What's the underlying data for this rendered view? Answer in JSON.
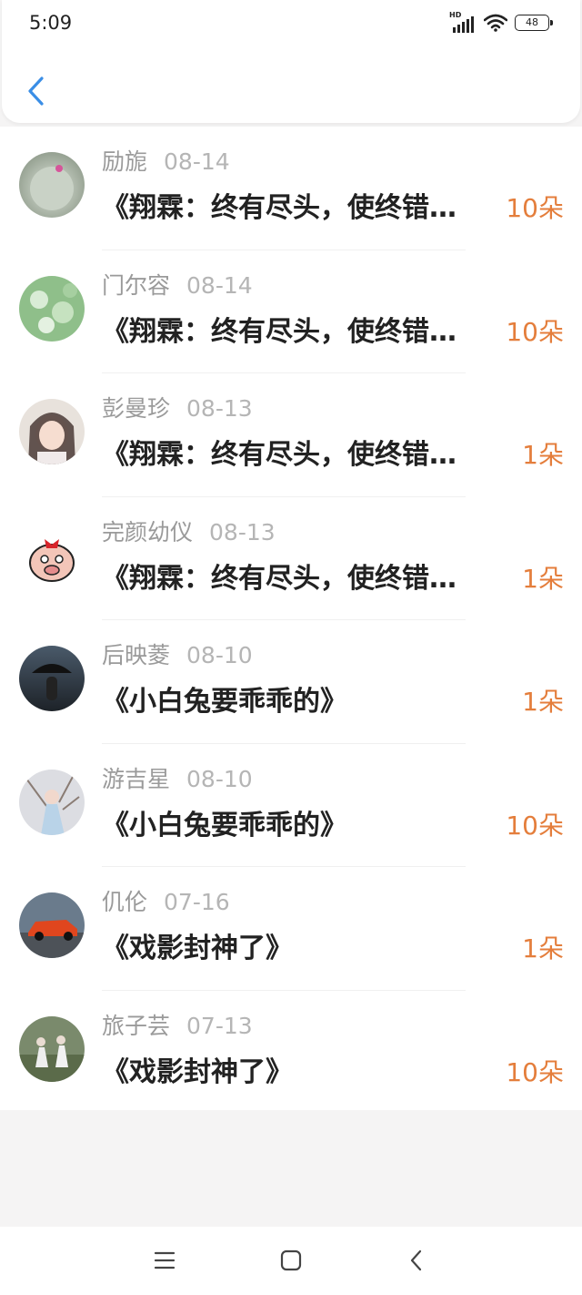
{
  "status_bar": {
    "time": "5:09",
    "signal_label": "HD",
    "battery_level": "48",
    "icons": [
      "signal-icon",
      "wifi-icon",
      "battery-icon"
    ]
  },
  "header": {
    "back_icon": "chevron-left-icon",
    "accent_color": "#3a8ee6"
  },
  "list": {
    "items": [
      {
        "name": "励旎",
        "date": "08-14",
        "title": "《翔霖：终有尽头，使终错…",
        "count": "10朵"
      },
      {
        "name": "门尔容",
        "date": "08-14",
        "title": "《翔霖：终有尽头，使终错…",
        "count": "10朵"
      },
      {
        "name": "彭曼珍",
        "date": "08-13",
        "title": "《翔霖：终有尽头，使终错…",
        "count": "1朵"
      },
      {
        "name": "完颜幼仪",
        "date": "08-13",
        "title": "《翔霖：终有尽头，使终错…",
        "count": "1朵"
      },
      {
        "name": "后映菱",
        "date": "08-10",
        "title": "《小白兔要乖乖的》",
        "count": "1朵"
      },
      {
        "name": "游吉星",
        "date": "08-10",
        "title": "《小白兔要乖乖的》",
        "count": "10朵"
      },
      {
        "name": "仉伦",
        "date": "07-16",
        "title": "《戏影封神了》",
        "count": "1朵"
      },
      {
        "name": "旅子芸",
        "date": "07-13",
        "title": "《戏影封神了》",
        "count": "10朵"
      }
    ],
    "count_color": "#e47e3c"
  },
  "nav_bar": {
    "icons": [
      "menu-icon",
      "home-icon",
      "back-icon"
    ]
  }
}
